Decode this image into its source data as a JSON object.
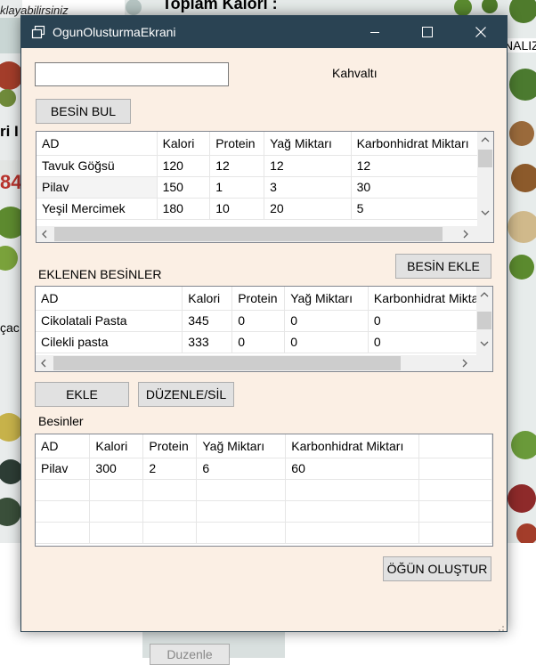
{
  "background": {
    "top_left_text": "klayabilirsiniz",
    "top_header": "Toplam Kalori :",
    "left_bold_fragment": "ri I",
    "left_red_number": "84",
    "left_text_fragment": "çacı",
    "right_fragment": "NALIZ",
    "bottom_button": "Duzenle"
  },
  "window": {
    "title": "OgunOlusturmaEkrani",
    "minimize_icon": "minimize-icon",
    "maximize_icon": "maximize-icon",
    "close_icon": "close-icon"
  },
  "search": {
    "value": "",
    "placeholder": ""
  },
  "meal_label": "Kahvaltı",
  "buttons": {
    "find": "BESİN BUL",
    "add_food": "BESİN EKLE",
    "add": "EKLE",
    "edit_delete": "DÜZENLE/SİL",
    "create_meal": "ÖĞÜN OLUŞTUR"
  },
  "foods_grid": {
    "headers": [
      "AD",
      "Kalori",
      "Protein",
      "Yağ Miktarı",
      "Karbonhidrat Miktarı"
    ],
    "rows": [
      [
        "Tavuk Göğsü",
        "120",
        "12",
        "12",
        "12"
      ],
      [
        "Pilav",
        "150",
        "1",
        "3",
        "30"
      ],
      [
        "Yeşil Mercimek",
        "180",
        "10",
        "20",
        "5"
      ]
    ]
  },
  "added_label": "EKLENEN BESİNLER",
  "added_grid": {
    "headers": [
      "AD",
      "Kalori",
      "Protein",
      "Yağ Miktarı",
      "Karbonhidrat Miktarı"
    ],
    "rows": [
      [
        "Cikolatali Pasta",
        "345",
        "0",
        "0",
        "0"
      ],
      [
        "Cilekli pasta",
        "333",
        "0",
        "0",
        "0"
      ]
    ]
  },
  "besinler_label": "Besinler",
  "besinler_grid": {
    "headers": [
      "AD",
      "Kalori",
      "Protein",
      "Yağ Miktarı",
      "Karbonhidrat Miktarı"
    ],
    "rows": [
      [
        "Pilav",
        "300",
        "2",
        "6",
        "60"
      ]
    ]
  },
  "colors": {
    "titlebar": "#2a4353",
    "window_bg": "#fbefe4",
    "button_bg": "#e1e1e1"
  }
}
